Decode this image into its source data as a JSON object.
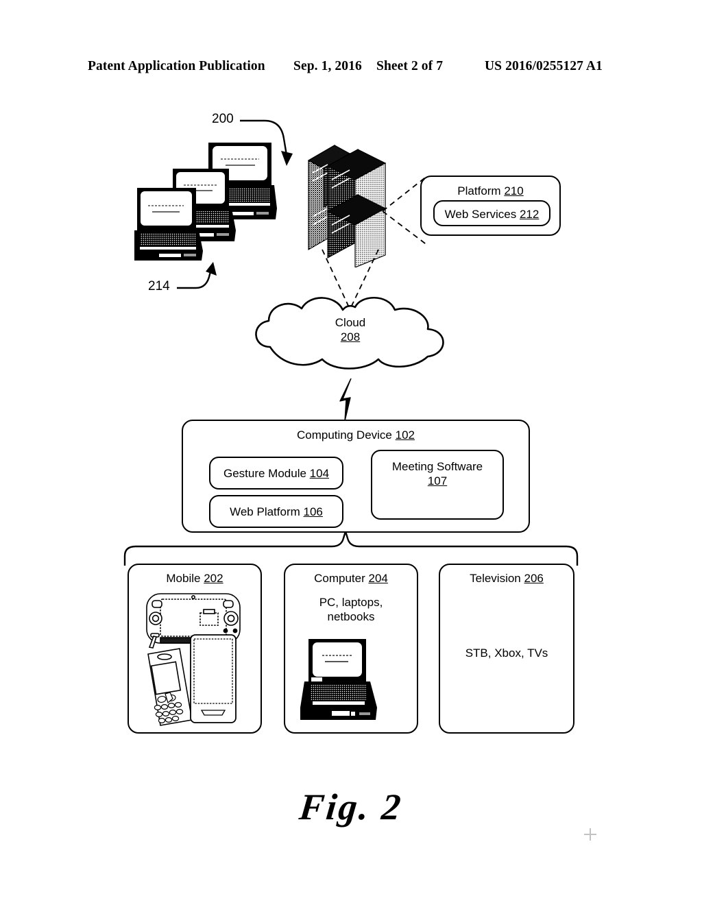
{
  "header": {
    "title": "Patent Application Publication",
    "date": "Sep. 1, 2016",
    "sheet": "Sheet 2 of 7",
    "publication_number": "US 2016/0255127 A1"
  },
  "figure": {
    "caption": "Fig. 2",
    "system_ref": "200",
    "laptops_ref": "214"
  },
  "platform": {
    "label": "Platform",
    "ref": "210",
    "web_services": {
      "label": "Web Services",
      "ref": "212"
    }
  },
  "cloud": {
    "label": "Cloud",
    "ref": "208"
  },
  "computing_device": {
    "label": "Computing Device",
    "ref": "102",
    "gesture_module": {
      "label": "Gesture Module",
      "ref": "104"
    },
    "web_platform": {
      "label": "Web Platform",
      "ref": "106"
    },
    "meeting_software": {
      "label": "Meeting Software",
      "ref": "107"
    }
  },
  "devices": [
    {
      "label": "Mobile",
      "ref": "202",
      "description": "",
      "icon": "mobile-devices-icon"
    },
    {
      "label": "Computer",
      "ref": "204",
      "description_line1": "PC, laptops,",
      "description_line2": "netbooks",
      "icon": "laptop-icon"
    },
    {
      "label": "Television",
      "ref": "206",
      "description": "STB, Xbox, TVs",
      "icon": "television-icon"
    }
  ],
  "icons": {
    "servers": "server-rack-icon",
    "laptop_stack": "laptop-stack-icon",
    "lightning": "lightning-bolt-connector-icon",
    "registration_mark": "registration-crosshair-icon"
  },
  "colors": {
    "ink": "#000000",
    "paper": "#ffffff",
    "halftone_mid": "#8a8a8a"
  }
}
